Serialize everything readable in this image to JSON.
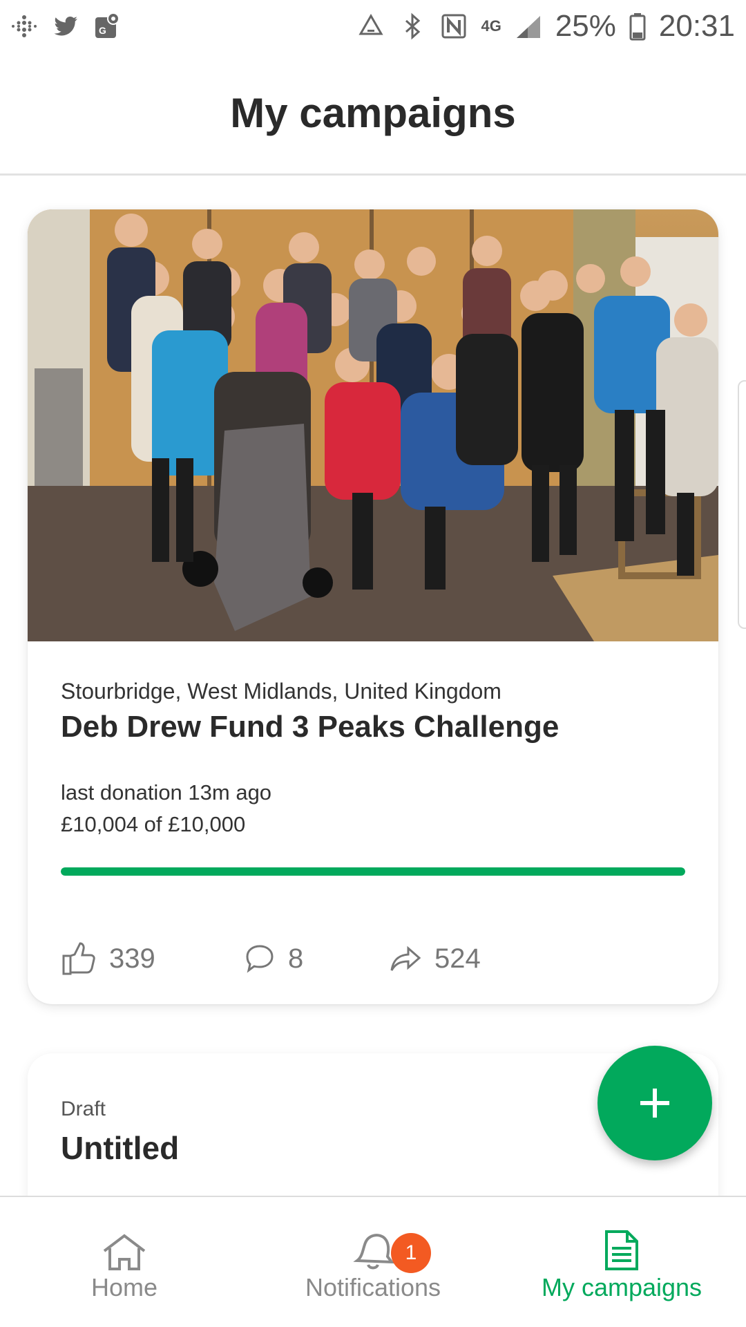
{
  "status_bar": {
    "battery": "25%",
    "time": "20:31",
    "network": "4G",
    "left_icons": [
      "grid-dots-icon",
      "twitter-icon",
      "maps-icon"
    ],
    "right_icons": [
      "sync-icon",
      "bluetooth-icon",
      "nfc-icon",
      "signal-icon",
      "battery-icon"
    ]
  },
  "header": {
    "title": "My campaigns"
  },
  "campaign": {
    "location": "Stourbridge, West Midlands, United Kingdom",
    "title": "Deb Drew Fund 3 Peaks Challenge",
    "last_donation": "last donation 13m ago",
    "raised": "£10,004 of £10,000",
    "progress": 1.0,
    "likes": "339",
    "comments": "8",
    "shares": "524"
  },
  "draft": {
    "label": "Draft",
    "title": "Untitled"
  },
  "fab": {
    "icon": "plus-icon"
  },
  "nav": {
    "home": "Home",
    "notifications": "Notifications",
    "notifications_badge": "1",
    "my_campaigns": "My campaigns"
  },
  "colors": {
    "accent": "#02a95c",
    "badge": "#f35a22"
  }
}
